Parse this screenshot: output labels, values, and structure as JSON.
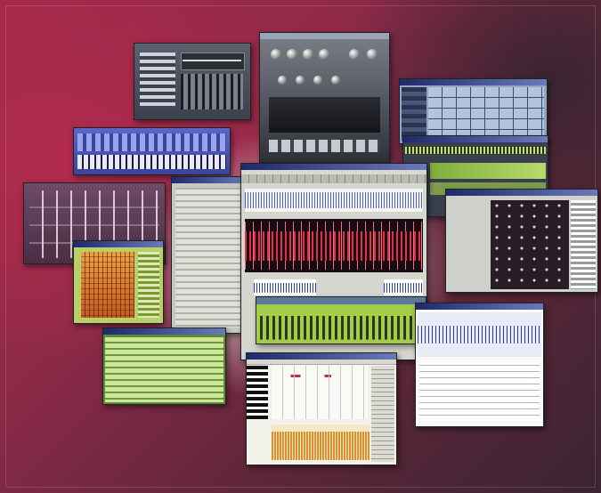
{
  "scene": {
    "description_label": "",
    "colors": {
      "bg_red": "#a4284b",
      "bg_dark": "#3b2432",
      "glow": "#ffffff",
      "waveform_red": "#e0304a",
      "waveform_blue": "#2a3ab0",
      "pattern_green": "#9ccc3a",
      "grid_blue": "#8fa6c8"
    }
  },
  "windows": [
    {
      "name": "mixer-module-window",
      "icon": "mixer"
    },
    {
      "name": "synth-rack-window",
      "icon": "knobs"
    },
    {
      "name": "pattern-grid-window",
      "icon": "grid"
    },
    {
      "name": "keyboard-synth-window",
      "icon": "keyboard"
    },
    {
      "name": "fader-mixer-window",
      "icon": "faders"
    },
    {
      "name": "main-waveform-editor",
      "icon": "waveform"
    },
    {
      "name": "step-sequencer-window",
      "icon": "sequencer"
    },
    {
      "name": "track-list-window",
      "icon": "list"
    },
    {
      "name": "piano-roll-window",
      "icon": "piano-roll"
    },
    {
      "name": "spectral-editor-window",
      "icon": "spectrum"
    },
    {
      "name": "drum-grid-window",
      "icon": "drum-grid"
    },
    {
      "name": "file-browser-window",
      "icon": "browser"
    },
    {
      "name": "patch-editor-window",
      "icon": "patch"
    }
  ]
}
